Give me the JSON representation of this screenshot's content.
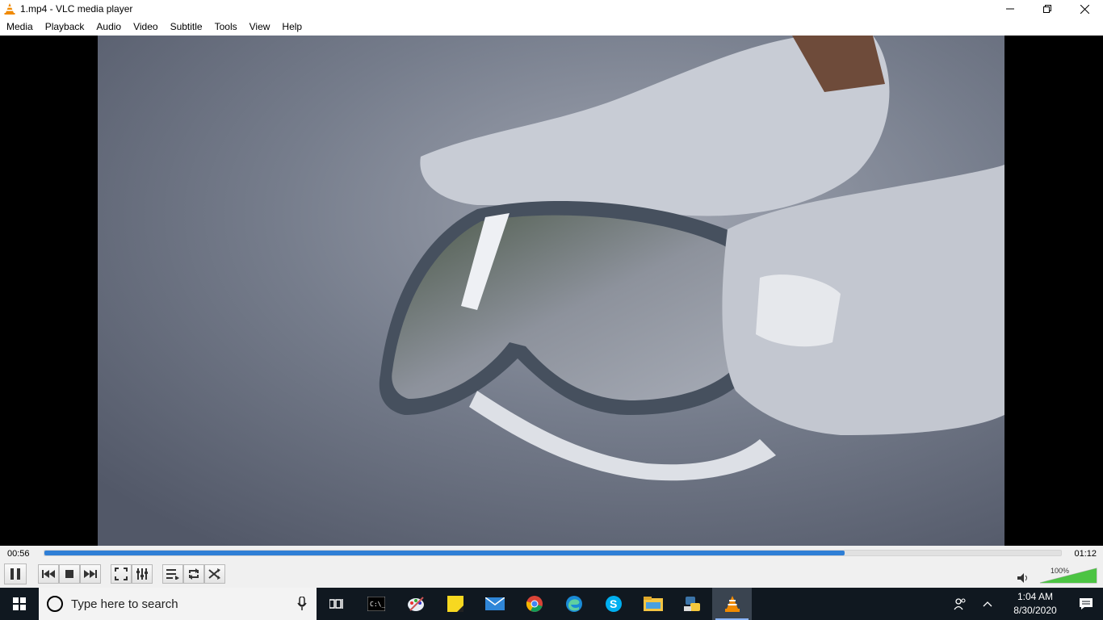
{
  "window": {
    "title": "1.mp4 - VLC media player"
  },
  "menu": {
    "items": [
      "Media",
      "Playback",
      "Audio",
      "Video",
      "Subtitle",
      "Tools",
      "View",
      "Help"
    ]
  },
  "player": {
    "elapsed": "00:56",
    "total": "01:12",
    "progress_fraction": 0.787,
    "volume_label": "100%",
    "volume_fraction": 1.0,
    "accent_color": "#2f7fd6"
  },
  "controls": {
    "buttons": [
      "pause-icon",
      "previous-icon",
      "stop-icon",
      "next-icon",
      "fullscreen-icon",
      "extended-settings-icon",
      "playlist-icon",
      "loop-icon",
      "shuffle-icon"
    ]
  },
  "taskbar": {
    "search_placeholder": "Type here to search",
    "apps": [
      "task-view-icon",
      "command-prompt-icon",
      "paint-icon",
      "sticky-notes-icon",
      "mail-icon",
      "chrome-icon",
      "edge-icon",
      "skype-icon",
      "file-explorer-icon",
      "python-icon",
      "vlc-icon"
    ],
    "time": "1:04 AM",
    "date": "8/30/2020"
  }
}
